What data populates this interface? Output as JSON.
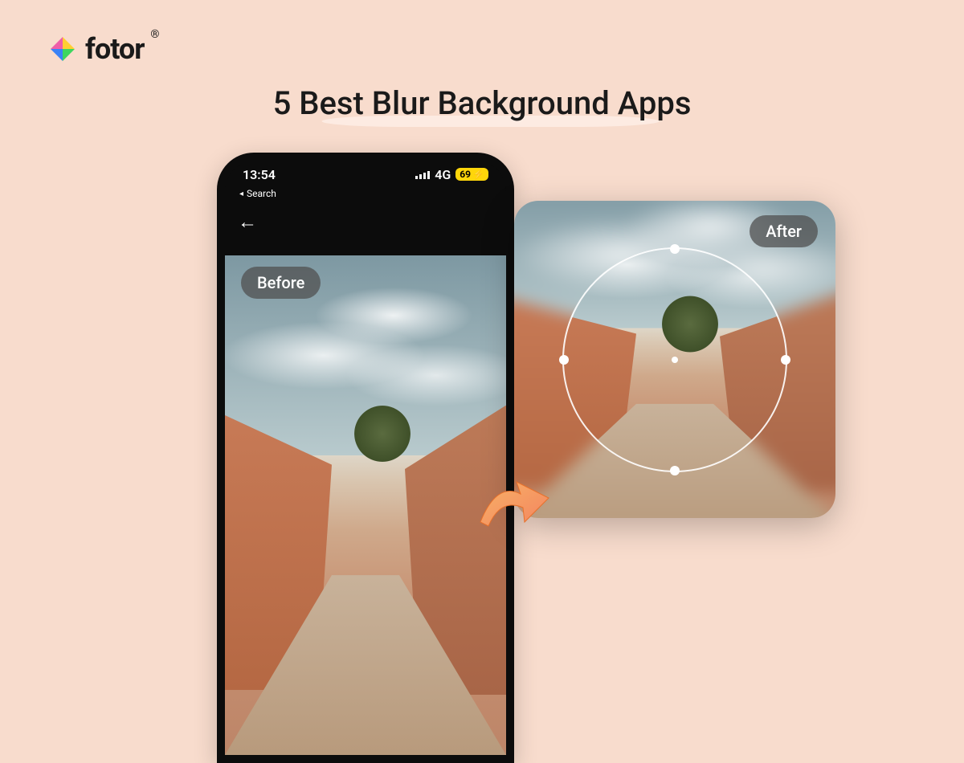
{
  "brand": {
    "name": "fotor",
    "trademark": "®"
  },
  "title": "5 Best Blur Background Apps",
  "phone": {
    "status": {
      "time": "13:54",
      "network": "4G",
      "battery_text": "69",
      "battery_icon": "⚡"
    },
    "breadcrumb": {
      "arrow": "◂",
      "label": "Search"
    }
  },
  "badges": {
    "before": "Before",
    "after": "After"
  }
}
